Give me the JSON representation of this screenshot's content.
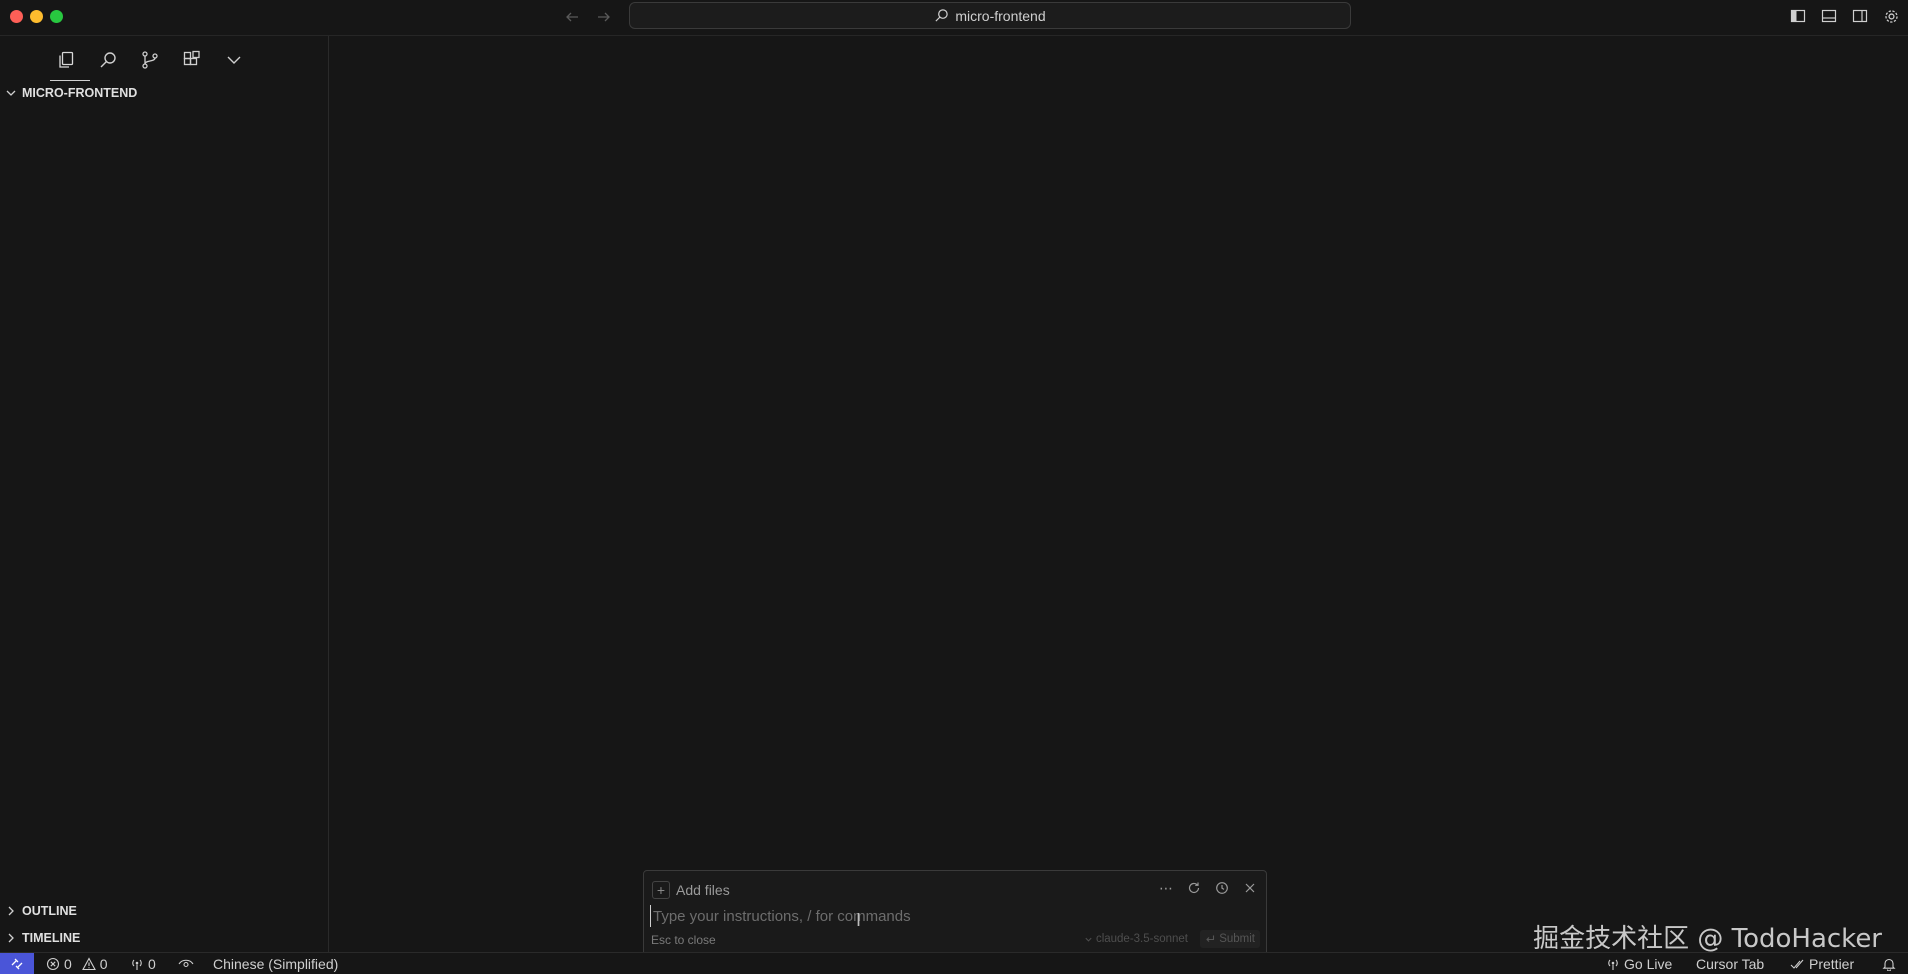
{
  "window": {
    "title": "micro-frontend"
  },
  "titlebar": {
    "back_icon": "arrow-left-icon",
    "forward_icon": "arrow-right-icon",
    "search_icon": "search-icon",
    "layout_icons": [
      "toggle-primary-sidebar-icon",
      "toggle-panel-icon",
      "toggle-secondary-sidebar-icon",
      "gear-icon"
    ]
  },
  "sidebar": {
    "activity_icons": [
      "explorer-icon",
      "search-icon",
      "source-control-icon",
      "extensions-icon",
      "chevron-down-icon"
    ],
    "explorer_title": "MICRO-FRONTEND",
    "outline_title": "OUTLINE",
    "timeline_title": "TIMELINE"
  },
  "prompt": {
    "add_files": "Add files",
    "placeholder": "Type your instructions, / for commands",
    "value": "",
    "esc_hint": "Esc to close",
    "model": "claude-3.5-sonnet",
    "submit": "Submit",
    "action_icons": [
      "more-icon",
      "refresh-icon",
      "history-icon",
      "close-icon"
    ]
  },
  "watermark": "掘金技术社区 @ TodoHacker",
  "statusbar": {
    "errors": "0",
    "warnings": "0",
    "ports": "0",
    "language": "Chinese (Simplified)",
    "go_live": "Go Live",
    "cursor_tab": "Cursor Tab",
    "prettier": "Prettier"
  },
  "colors": {
    "background": "#161616",
    "remote_indicator": "#4a55d8",
    "close_red": "#fe5f57",
    "minimize_yellow": "#febc2e",
    "maximize_green": "#28c840"
  }
}
